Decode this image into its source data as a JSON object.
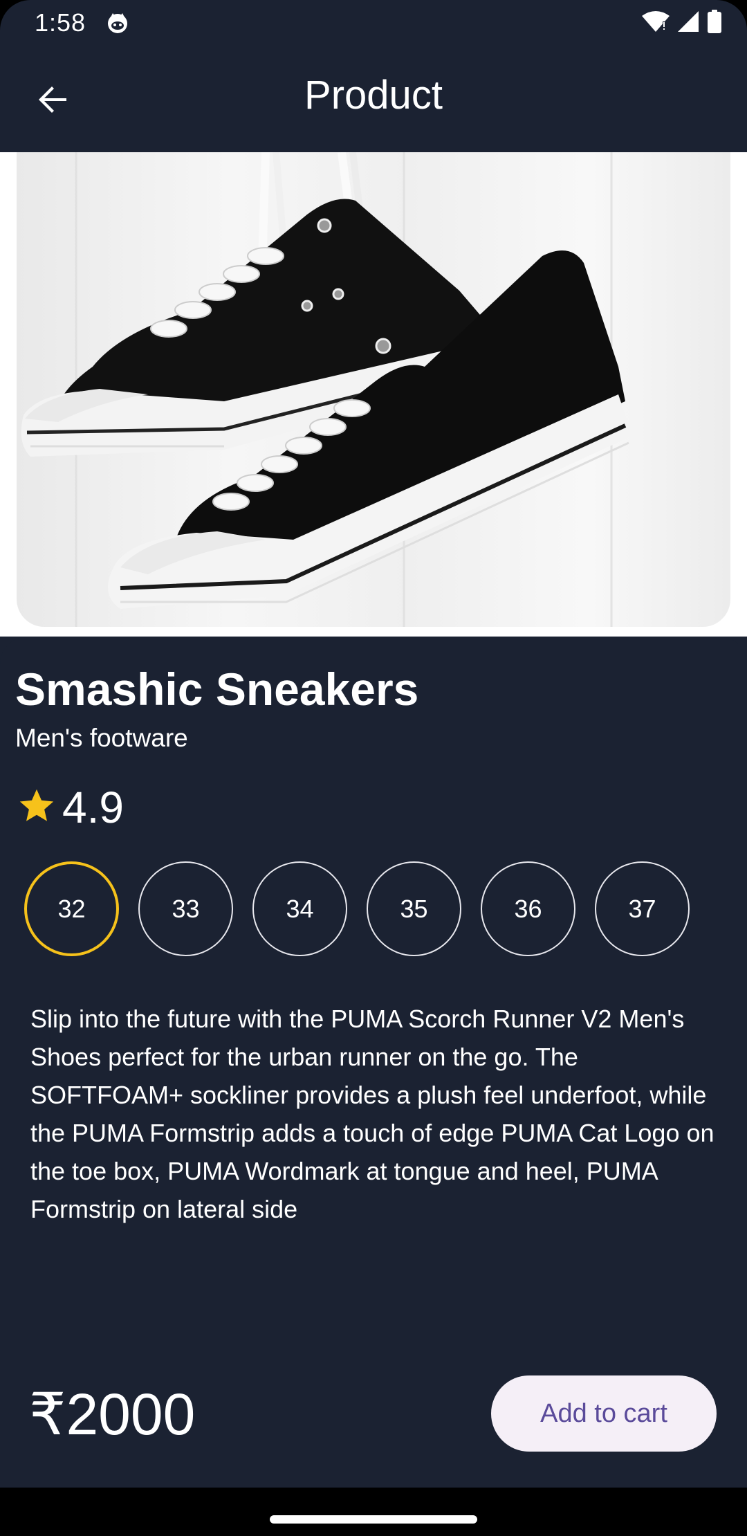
{
  "status_bar": {
    "time": "1:58",
    "icons": [
      "cat-notification-icon",
      "wifi-icon",
      "signal-icon",
      "battery-icon"
    ]
  },
  "app_bar": {
    "title": "Product",
    "back_icon": "arrow-back-icon"
  },
  "hero": {
    "image_subject": "black canvas sneakers hanging by laces"
  },
  "product": {
    "name": "Smashic Sneakers",
    "category": "Men's footware",
    "rating": "4.9",
    "rating_icon": "star-icon",
    "sizes": [
      "32",
      "33",
      "34",
      "35",
      "36",
      "37"
    ],
    "selected_size": "32",
    "description": "Slip into the future with the PUMA Scorch Runner V2 Men's Shoes perfect for the urban runner on the go. The SOFTFOAM+ sockliner provides a plush feel underfoot, while the PUMA Formstrip adds a touch of edge  PUMA Cat Logo on the toe box, PUMA Wordmark at tongue and heel, PUMA Formstrip on lateral side",
    "price": "₹2000"
  },
  "actions": {
    "add_to_cart_label": "Add to cart"
  },
  "colors": {
    "background": "#1b2232",
    "accent_selected": "#f6c21b",
    "button_bg": "#f5eff7",
    "button_text": "#5a4a9a"
  }
}
